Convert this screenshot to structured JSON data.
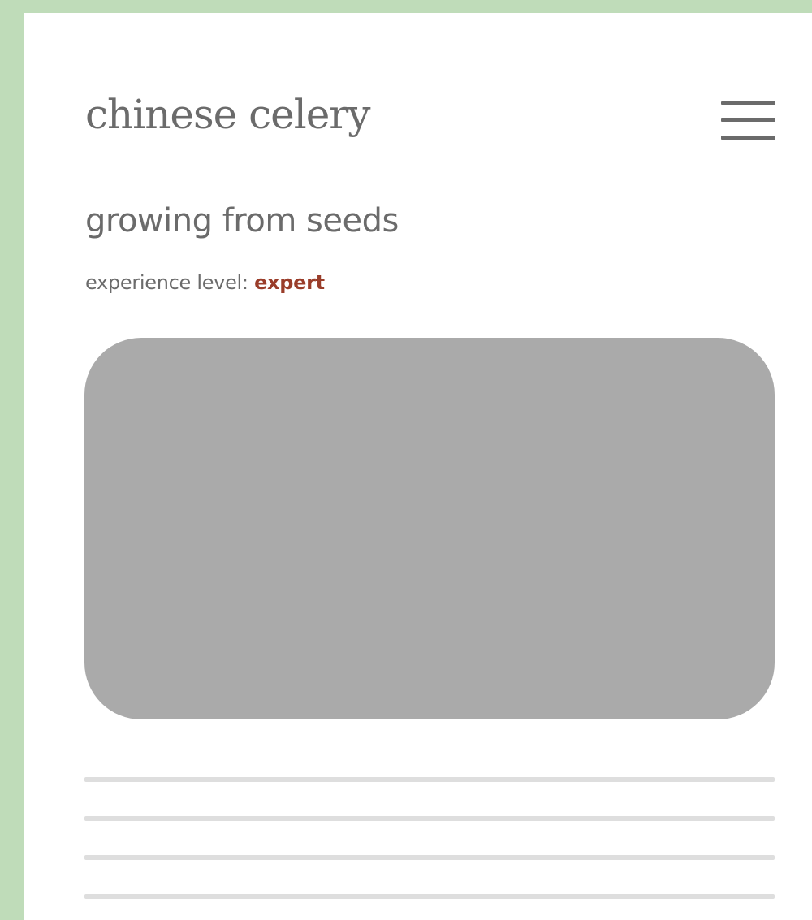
{
  "page": {
    "background_color": "#bfdcb9",
    "frame_color": "#ffffff",
    "text_color": "#6b6b6b",
    "accent_color": "#9a3d2a"
  },
  "header": {
    "title": "chinese celery",
    "menu_icon": "hamburger-menu-icon"
  },
  "section": {
    "title": "growing from seeds",
    "experience_label": "experience level:",
    "experience_value": "expert"
  },
  "media": {
    "placeholder_color": "#aaaaaa"
  },
  "text_placeholder": {
    "line_count": 4,
    "line_color": "#dedede"
  }
}
